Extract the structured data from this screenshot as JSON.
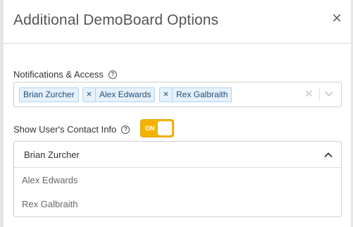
{
  "modal": {
    "title": "Additional DemoBoard Options",
    "close_icon": "close-icon"
  },
  "notifications": {
    "label": "Notifications & Access",
    "help_icon": "question-circle-icon",
    "selected": [
      {
        "label": "Brian Zurcher",
        "removable": false
      },
      {
        "label": "Alex Edwards",
        "removable": true
      },
      {
        "label": "Rex Galbraith",
        "removable": true
      }
    ],
    "clear_icon": "clear-x-icon",
    "dropdown_icon": "chevron-down-icon"
  },
  "contact_info": {
    "label": "Show User's Contact Info",
    "help_icon": "question-circle-icon",
    "toggle_state": "ON",
    "toggle_on": true,
    "dropdown": {
      "selected": "Brian Zurcher",
      "expanded": true,
      "chevron_icon": "chevron-up-icon",
      "options": [
        "Alex Edwards",
        "Rex Galbraith"
      ]
    }
  },
  "colors": {
    "toggle_on": "#f5b301",
    "chip_bg": "#e6f1fb",
    "chip_border": "#b3d4f5"
  }
}
